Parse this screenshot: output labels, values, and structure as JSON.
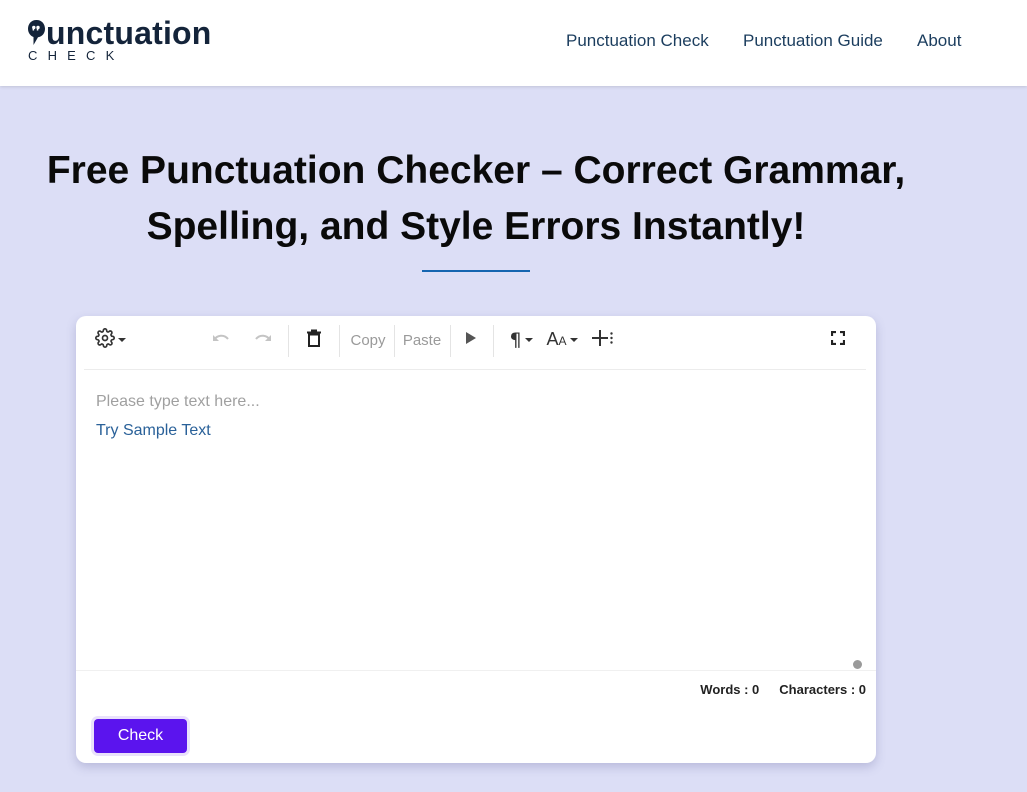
{
  "header": {
    "logo": {
      "main_rest": "unctuation",
      "sub": "CHECK"
    },
    "nav": [
      {
        "label": "Punctuation Check"
      },
      {
        "label": "Punctuation Guide"
      },
      {
        "label": "About"
      }
    ]
  },
  "hero": {
    "title_line1": "Free Punctuation Checker – Correct Grammar,",
    "title_line2": "Spelling, and Style Errors Instantly!",
    "accent_color": "#1565b0"
  },
  "editor": {
    "toolbar": {
      "settings_icon": "gear-icon",
      "undo_icon": "undo-icon",
      "redo_icon": "redo-icon",
      "delete_icon": "trash-icon",
      "copy_label": "Copy",
      "paste_label": "Paste",
      "play_icon": "play-icon",
      "paragraph_icon": "pilcrow-icon",
      "font_size_icon": "font-size-icon",
      "insert_icon": "insert-icon",
      "fullscreen_icon": "fullscreen-icon"
    },
    "placeholder": "Please type text here...",
    "sample_link": "Try Sample Text",
    "words_label": "Words : 0",
    "characters_label": "Characters : 0",
    "check_button": "Check",
    "check_button_color": "#5b14ee"
  }
}
